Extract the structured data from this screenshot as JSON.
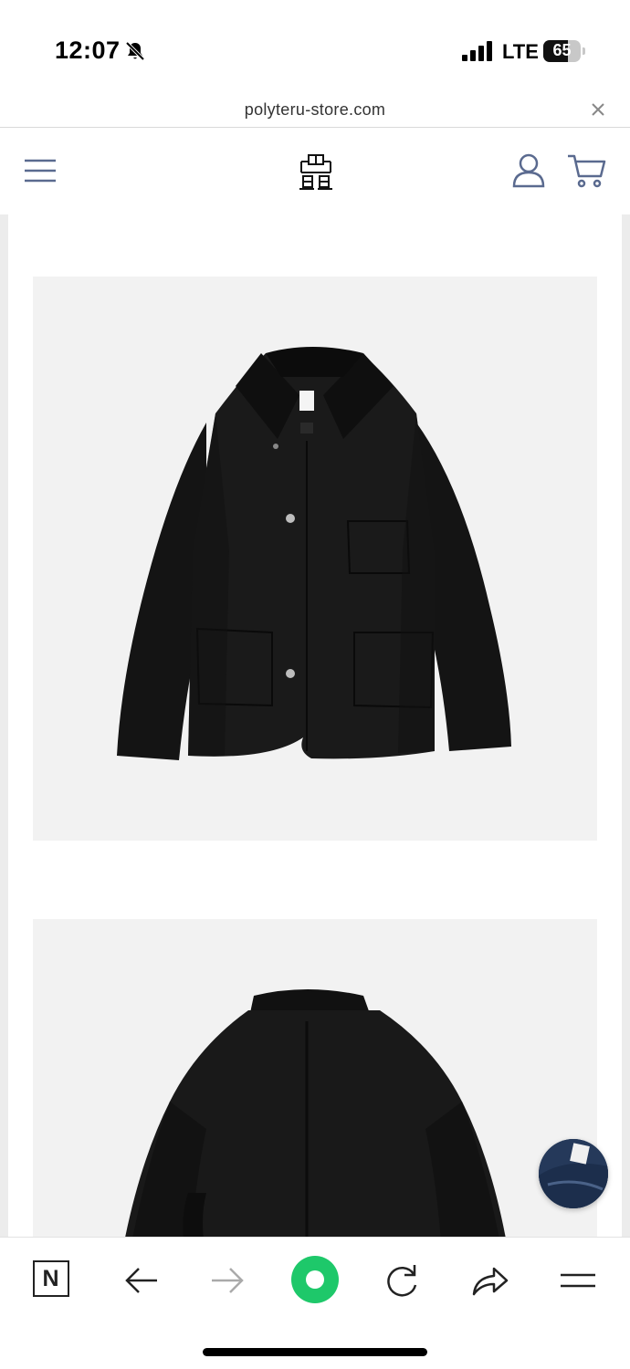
{
  "status_bar": {
    "time": "12:07",
    "network": "LTE",
    "battery_percent": "65",
    "battery_level": 0.65,
    "icons": [
      "bell-slash-icon",
      "cellular-signal-icon",
      "battery-icon"
    ]
  },
  "browser": {
    "url": "polyteru-store.com",
    "close_icon": "close-icon"
  },
  "site_header": {
    "menu_icon": "hamburger-menu-icon",
    "logo_icon": "polyteru-logo",
    "account_icon": "account-icon",
    "cart_icon": "cart-icon",
    "accent_color": "#5a6a8f"
  },
  "gallery": {
    "images": [
      {
        "subject": "black-work-jacket-front"
      },
      {
        "subject": "black-work-jacket-back"
      }
    ],
    "background_color": "#f2f2f2"
  },
  "floating_thumbnail": {
    "subject": "denim-product-thumbnail"
  },
  "toolbar": {
    "n_label": "N",
    "items": [
      "naver-n-icon",
      "back-arrow-icon",
      "forward-arrow-icon",
      "green-dot-icon",
      "refresh-icon",
      "share-icon",
      "menu-icon"
    ],
    "green_color": "#1ec86a"
  }
}
